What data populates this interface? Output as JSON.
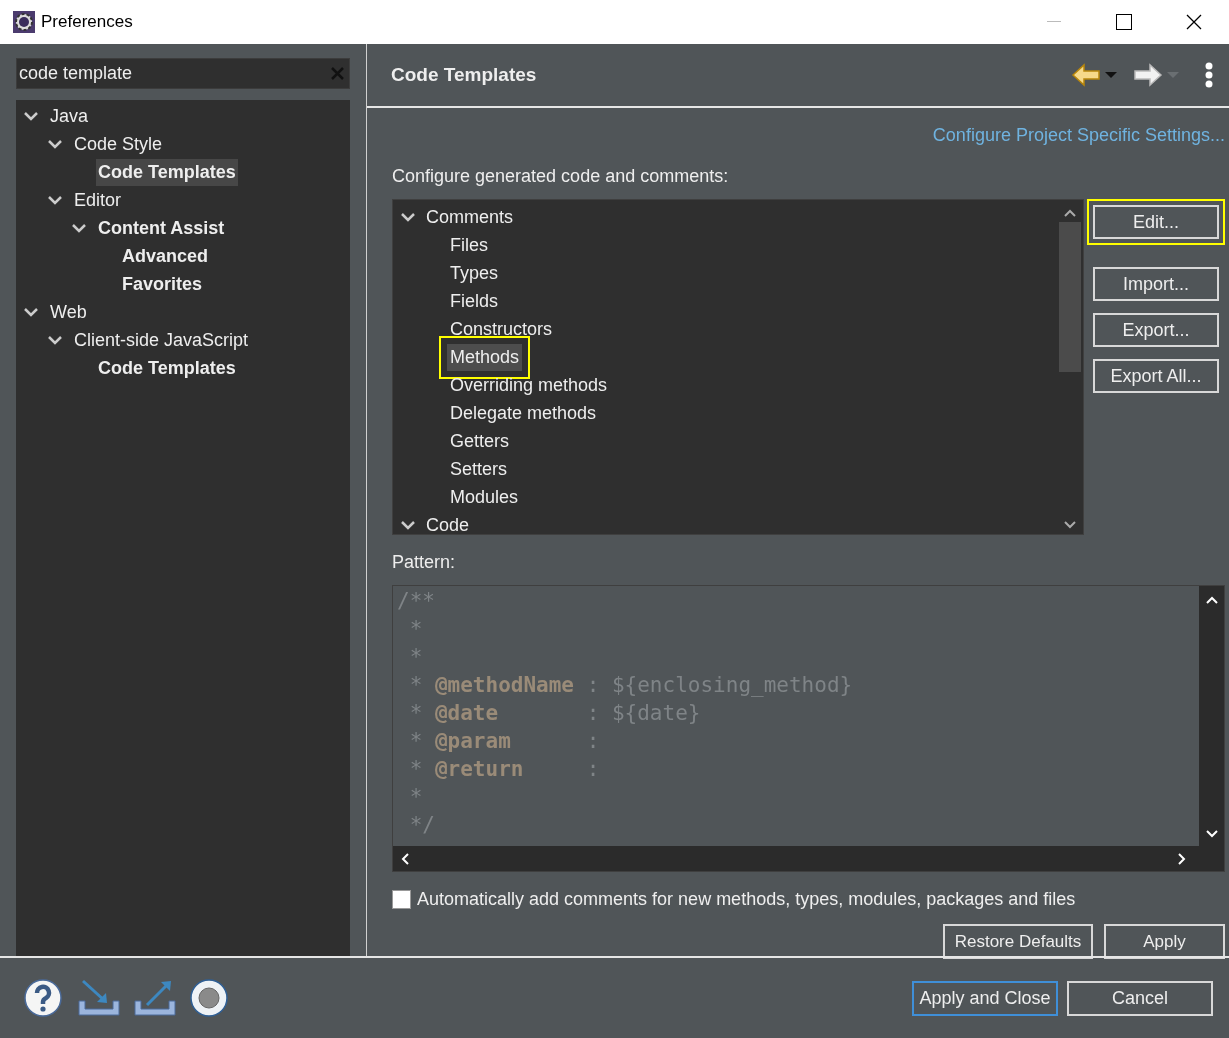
{
  "window": {
    "title": "Preferences"
  },
  "filter": {
    "value": "code template"
  },
  "nav_tree": [
    {
      "label": "Java",
      "bold": false,
      "selected": false,
      "expanded": true,
      "children": [
        {
          "label": "Code Style",
          "bold": false,
          "selected": false,
          "expanded": true,
          "children": [
            {
              "label": "Code Templates",
              "bold": true,
              "selected": true
            }
          ]
        },
        {
          "label": "Editor",
          "bold": false,
          "selected": false,
          "expanded": true,
          "children": [
            {
              "label": "Content Assist",
              "bold": true,
              "selected": false,
              "expanded": true,
              "children": [
                {
                  "label": "Advanced",
                  "bold": true,
                  "selected": false
                },
                {
                  "label": "Favorites",
                  "bold": true,
                  "selected": false
                }
              ]
            }
          ]
        }
      ]
    },
    {
      "label": "Web",
      "bold": false,
      "selected": false,
      "expanded": true,
      "children": [
        {
          "label": "Client-side JavaScript",
          "bold": false,
          "selected": false,
          "expanded": true,
          "children": [
            {
              "label": "Code Templates",
              "bold": true,
              "selected": false
            }
          ]
        }
      ]
    }
  ],
  "page": {
    "title": "Code Templates",
    "link": "Configure Project Specific Settings...",
    "description": "Configure generated code and comments:"
  },
  "template_tree": [
    {
      "label": "Comments",
      "expanded": true,
      "selected": false,
      "highlighted": false,
      "children": [
        {
          "label": "Files",
          "selected": false,
          "highlighted": false
        },
        {
          "label": "Types",
          "selected": false,
          "highlighted": false
        },
        {
          "label": "Fields",
          "selected": false,
          "highlighted": false
        },
        {
          "label": "Constructors",
          "selected": false,
          "highlighted": false
        },
        {
          "label": "Methods",
          "selected": true,
          "highlighted": true
        },
        {
          "label": "Overriding methods",
          "selected": false,
          "highlighted": false
        },
        {
          "label": "Delegate methods",
          "selected": false,
          "highlighted": false
        },
        {
          "label": "Getters",
          "selected": false,
          "highlighted": false
        },
        {
          "label": "Setters",
          "selected": false,
          "highlighted": false
        },
        {
          "label": "Modules",
          "selected": false,
          "highlighted": false
        }
      ]
    },
    {
      "label": "Code",
      "expanded": true,
      "selected": false,
      "highlighted": false
    }
  ],
  "side_buttons": [
    {
      "label": "Edit...",
      "highlighted": true
    },
    {
      "label": "Import...",
      "highlighted": false
    },
    {
      "label": "Export...",
      "highlighted": false
    },
    {
      "label": "Export All...",
      "highlighted": false
    }
  ],
  "pattern": {
    "label": "Pattern:",
    "lines": [
      [
        {
          "text": "/**",
          "kind": "comment"
        }
      ],
      [
        {
          "text": " *",
          "kind": "comment"
        }
      ],
      [
        {
          "text": " *",
          "kind": "comment"
        }
      ],
      [
        {
          "text": " * ",
          "kind": "comment"
        },
        {
          "text": "@methodName",
          "kind": "tag"
        },
        {
          "text": " : ${enclosing_method}",
          "kind": "comment"
        }
      ],
      [
        {
          "text": " * ",
          "kind": "comment"
        },
        {
          "text": "@date",
          "kind": "tag"
        },
        {
          "text": "       : ${date}",
          "kind": "comment"
        }
      ],
      [
        {
          "text": " * ",
          "kind": "comment"
        },
        {
          "text": "@param",
          "kind": "tag"
        },
        {
          "text": "      :",
          "kind": "comment"
        }
      ],
      [
        {
          "text": " * ",
          "kind": "comment"
        },
        {
          "text": "@return",
          "kind": "tag"
        },
        {
          "text": "     :",
          "kind": "comment"
        }
      ],
      [
        {
          "text": " *",
          "kind": "comment"
        }
      ],
      [
        {
          "text": " */",
          "kind": "comment"
        }
      ]
    ]
  },
  "auto_comments": {
    "label": "Automatically add comments for new methods, types, modules, packages and files",
    "checked": false
  },
  "page_buttons": [
    "Restore Defaults",
    "Apply"
  ],
  "dialog_buttons": [
    {
      "label": "Apply and Close",
      "default": true
    },
    {
      "label": "Cancel",
      "default": false
    }
  ]
}
